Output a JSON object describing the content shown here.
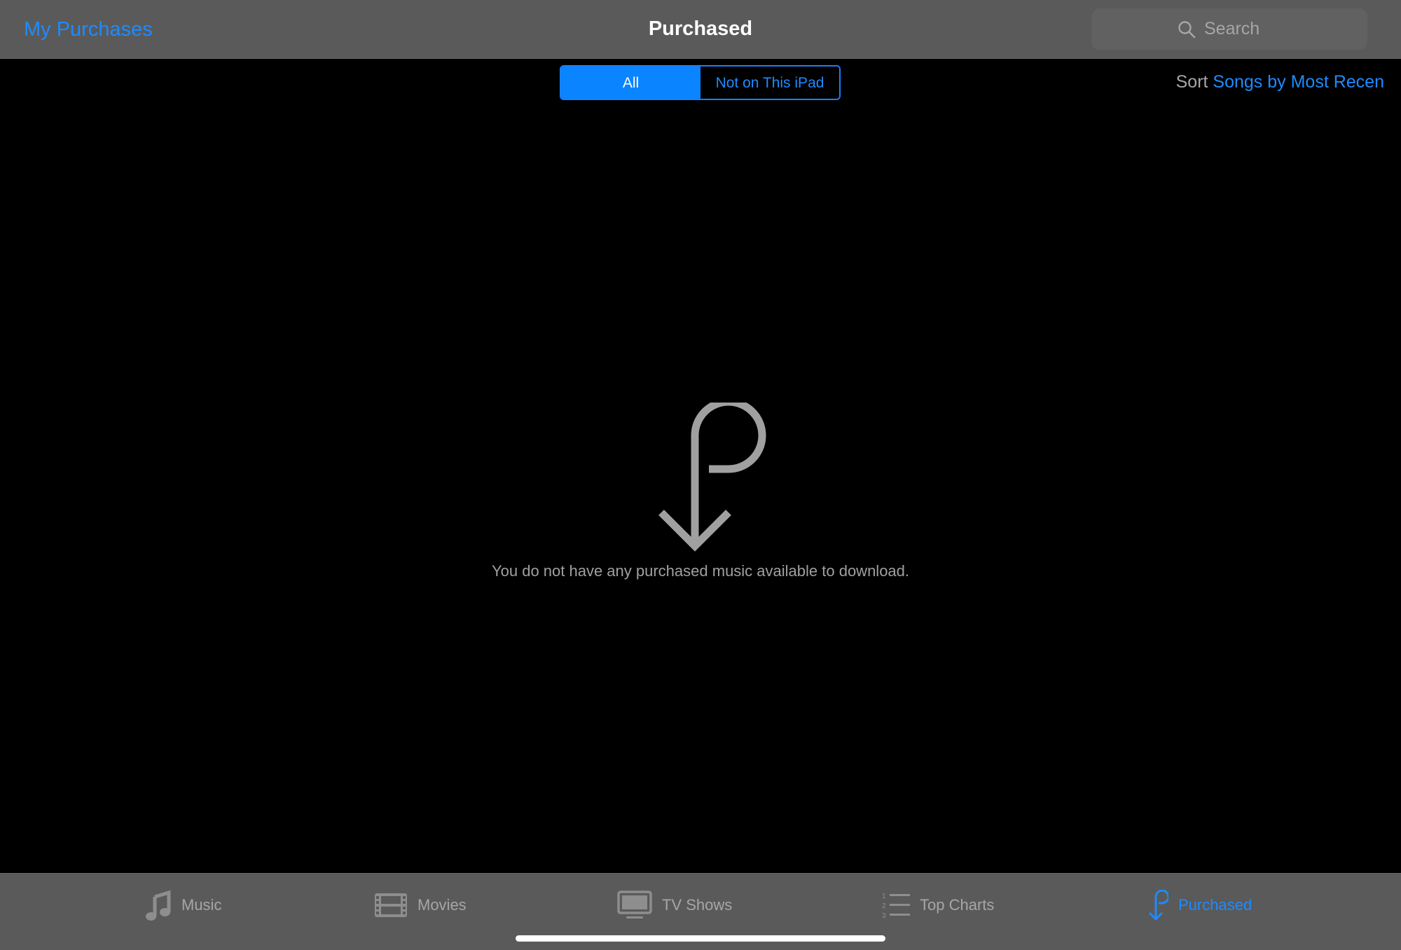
{
  "navbar": {
    "back_label": "My Purchases",
    "title": "Purchased",
    "search_placeholder": "Search"
  },
  "segments": {
    "all_label": "All",
    "not_on_device_label": "Not on This iPad",
    "selected": "All"
  },
  "sort": {
    "label": "Sort",
    "value": "Songs by Most Recen"
  },
  "empty_state": {
    "icon": "purchased-arrow-icon",
    "message": "You do not have any purchased music available to download."
  },
  "tabbar": {
    "tabs": [
      {
        "label": "Music",
        "icon": "music-note-icon"
      },
      {
        "label": "Movies",
        "icon": "film-strip-icon"
      },
      {
        "label": "TV Shows",
        "icon": "tv-icon"
      },
      {
        "label": "Top Charts",
        "icon": "numbered-list-icon"
      },
      {
        "label": "Purchased",
        "icon": "purchased-arrow-icon"
      }
    ],
    "active": "Purchased"
  },
  "colors": {
    "accent": "#1e8bff",
    "bar_background": "#5a5a5a",
    "content_background": "#000000",
    "muted_text": "#a6a6a6"
  }
}
